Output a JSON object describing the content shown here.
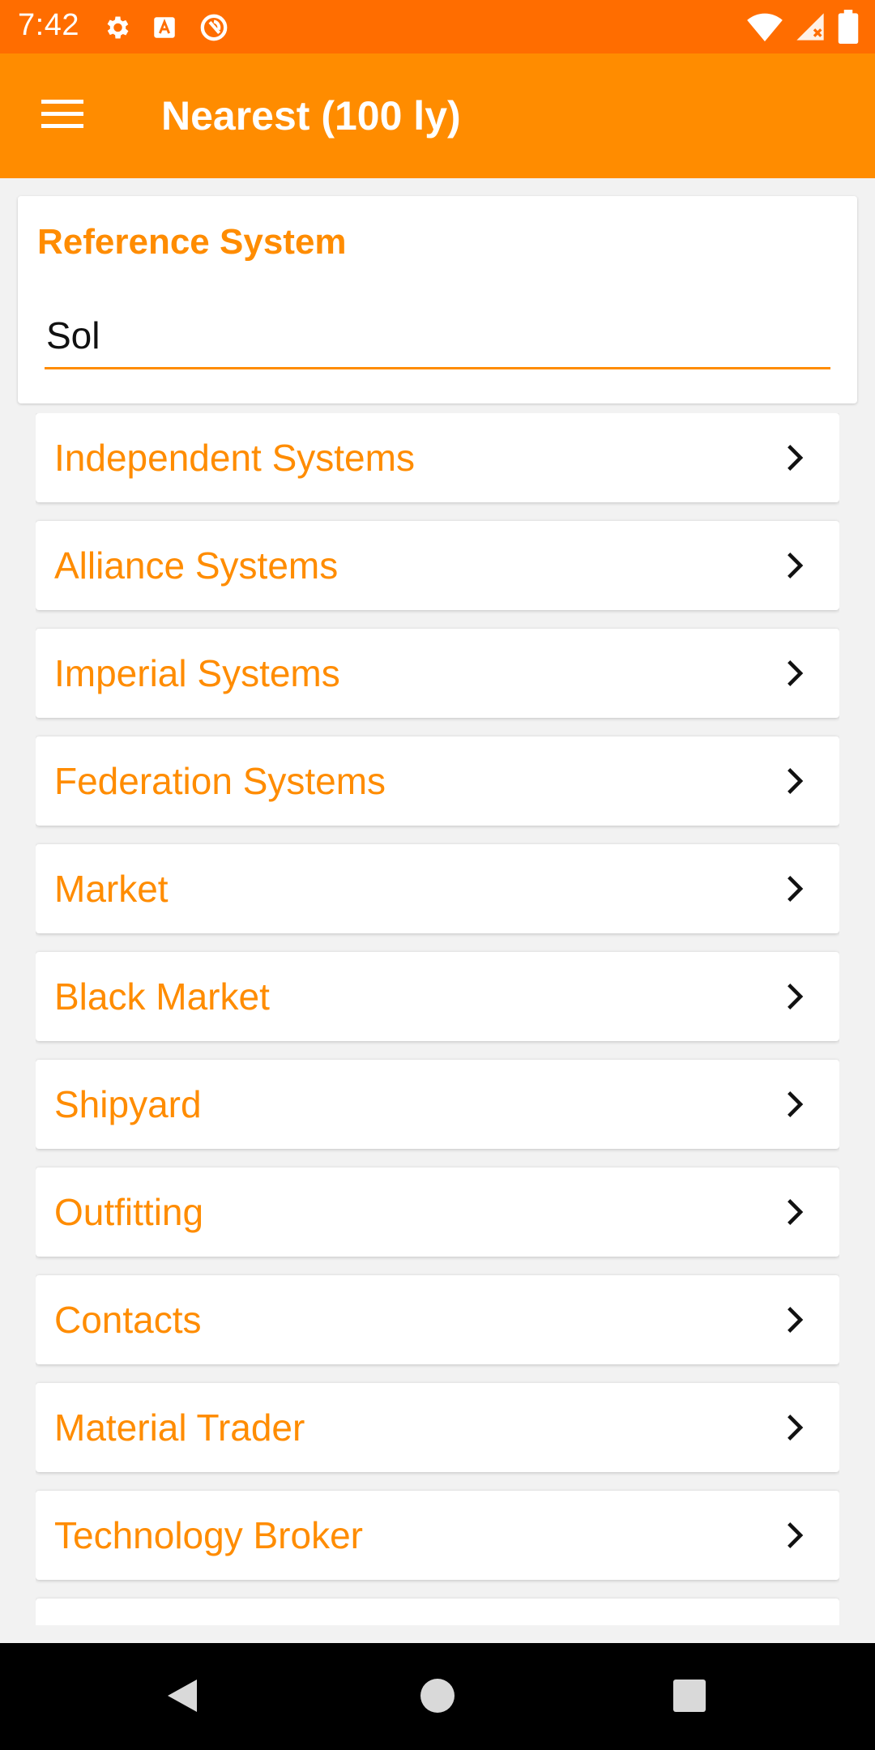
{
  "status_bar": {
    "time": "7:42",
    "left_icons": [
      "gear-icon",
      "font-a-icon",
      "sync-circle-icon"
    ],
    "right_icons": [
      "wifi-icon",
      "cellular-signal-icon",
      "battery-icon"
    ]
  },
  "app_bar": {
    "menu_icon": "hamburger-menu-icon",
    "title": "Nearest (100 ly)"
  },
  "reference": {
    "label": "Reference System",
    "value": "Sol"
  },
  "items": [
    {
      "label": "Independent Systems"
    },
    {
      "label": "Alliance Systems"
    },
    {
      "label": "Imperial Systems"
    },
    {
      "label": "Federation Systems"
    },
    {
      "label": "Market"
    },
    {
      "label": "Black Market"
    },
    {
      "label": "Shipyard"
    },
    {
      "label": "Outfitting"
    },
    {
      "label": "Contacts"
    },
    {
      "label": "Material Trader"
    },
    {
      "label": "Technology Broker"
    }
  ],
  "nav_bar": {
    "buttons": [
      "back-triangle-icon",
      "home-circle-icon",
      "recents-square-icon"
    ]
  },
  "colors": {
    "status_bar": "#ff6d00",
    "app_bar": "#ff8c00",
    "accent_text": "#ff8c00",
    "background": "#f2f2f2"
  }
}
